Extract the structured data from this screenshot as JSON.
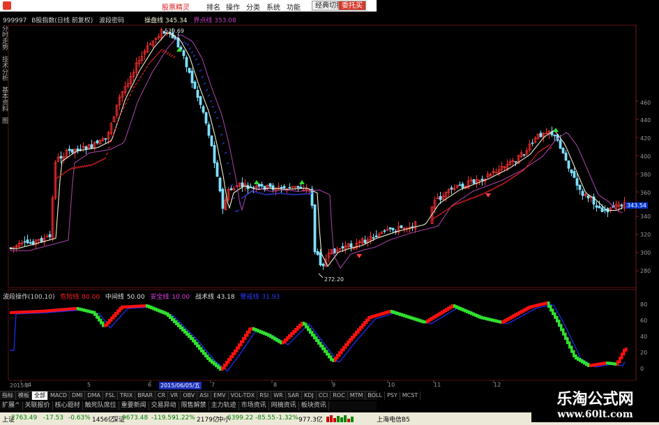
{
  "menubar": {
    "title": "股票精灵",
    "items": [
      "排名",
      "操作",
      "分类",
      "系统",
      "功能"
    ],
    "btn_switch": "经典切换",
    "btn_trade": "委托买"
  },
  "left_tabs": [
    "分时走势",
    "技术分析",
    "基本资料",
    "图"
  ],
  "info": {
    "code": "999997",
    "name": "B股指数(日线 前复权)",
    "formula": "波段密码",
    "line1_label": "操盘线",
    "line1_value": "345.34",
    "line2_label": "界点线",
    "line2_value": "353.08"
  },
  "annotations": {
    "high": "539.69",
    "low": "272.20"
  },
  "axis": {
    "right_ticks": [
      "460",
      "440",
      "420",
      "400",
      "380",
      "360",
      "340",
      "320",
      "300",
      "280"
    ],
    "price_tag": "343.54",
    "ind_ticks": [
      "80",
      "60",
      "40",
      "20",
      "0"
    ]
  },
  "indicator": {
    "name": "波段操作(100,10)",
    "l1_label": "危险线",
    "l1_value": "80.00",
    "l2_label": "中间线",
    "l2_value": "50.00",
    "l3_label": "安全线",
    "l3_value": "10.00",
    "l4_label": "战术线",
    "l4_value": "43.18",
    "l5_label": "警戒线",
    "l5_value": "31.93"
  },
  "dates": {
    "items": [
      "2015年",
      "4",
      "5",
      "6",
      "7",
      "8",
      "9",
      "10",
      "11",
      "12"
    ],
    "selected": "2015/06/05/五"
  },
  "ind_tabs": [
    "指标",
    "模板",
    "全部",
    "MACD",
    "DMI",
    "DMA",
    "FSL",
    "TRIX",
    "BRAR",
    "CR",
    "VR",
    "OBV",
    "ASI",
    "EMV",
    "VOL-TDX",
    "RSI",
    "WR",
    "SAR",
    "KDJ",
    "CCI",
    "ROC",
    "MTM",
    "BOLL",
    "PSY",
    "MCST"
  ],
  "info_tabs": [
    "扩展^",
    "关联报价",
    "核心题材",
    "触死队席位",
    "重要新闻",
    "交易异动",
    "限售解禁",
    "主力轨迹",
    "市场资讯",
    "网摘资讯",
    "板块资讯"
  ],
  "status": {
    "sh_label": "上证",
    "sh_value": "2763.49",
    "sh_chg": "-17.53",
    "sh_pct": "-0.63%",
    "sh_amt": "1456亿",
    "sz_label": "深证",
    "sz_value": "9673.48",
    "sz_chg": "-119.59",
    "sz_pct": "-1.22%",
    "sz_amt": "2179亿",
    "zx_label": "中小",
    "zx_value": "6399.22",
    "zx_chg": "-85.55",
    "zx_pct": "-1.32%",
    "zx_amt": "977.3亿",
    "server": "上海电信B5"
  },
  "watermark": {
    "title": "乐淘公式网",
    "url": "www.60lt.com"
  },
  "colors": {
    "up": "#ff3030",
    "down": "#7fe0ff",
    "ma_short": "#f0f0d0",
    "ma_long": "#a040a0",
    "stair_red": "#e02020",
    "stair_blue": "#3040e0",
    "ind_red": "#ff1010",
    "ind_green": "#30e030",
    "ind_blue": "#2030ff"
  }
}
